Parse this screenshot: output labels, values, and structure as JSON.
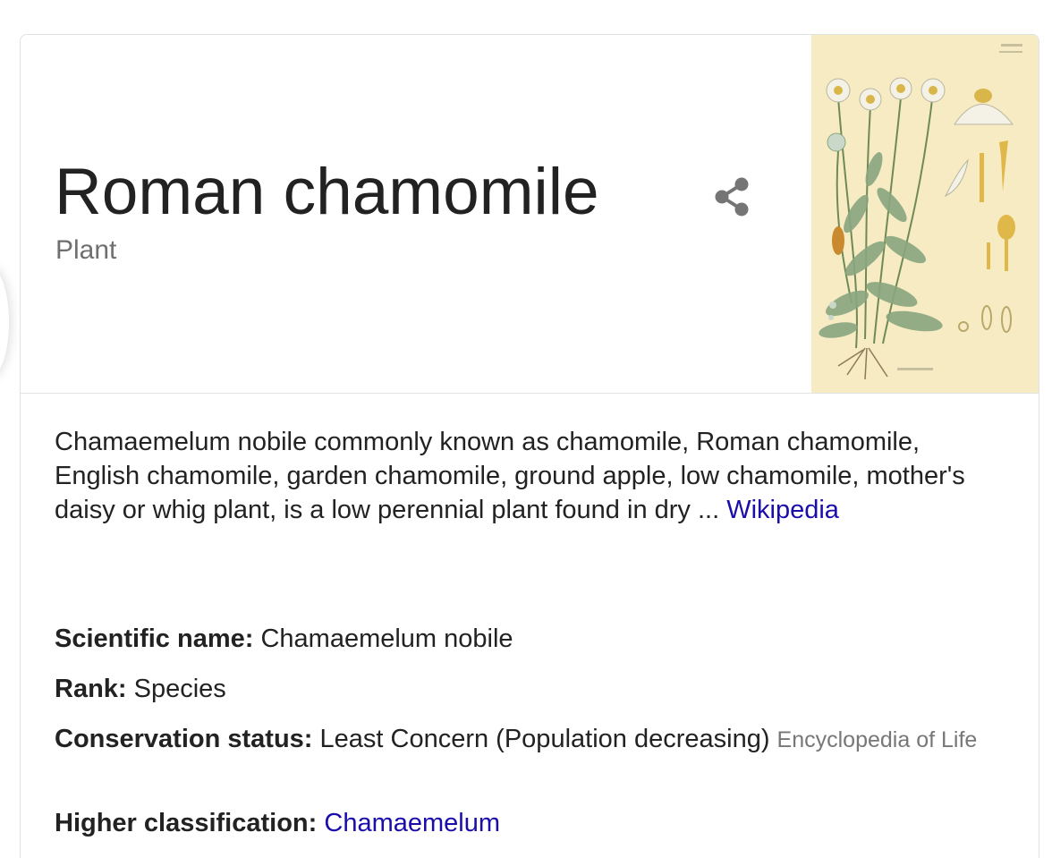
{
  "card": {
    "title": "Roman chamomile",
    "subtitle": "Plant",
    "image_alt": "Botanical illustration of Roman chamomile",
    "description": {
      "text": "Chamaemelum nobile commonly known as chamomile, Roman chamomile, English chamomile, garden chamomile, ground apple, low chamomile, mother's daisy or whig plant, is a low perennial plant found in dry ... ",
      "source_link": "Wikipedia"
    },
    "facts": {
      "scientific_name": {
        "label": "Scientific name:",
        "value": " Chamaemelum nobile"
      },
      "rank": {
        "label": "Rank:",
        "value": " Species"
      },
      "conservation_status": {
        "label": "Conservation status:",
        "value": " Least Concern (Population decreasing) ",
        "source": "Encyclopedia of Life"
      },
      "higher_classification": {
        "label": "Higher classification:",
        "value": "Chamaemelum"
      }
    }
  },
  "colors": {
    "link": "#1a0dab",
    "text": "#222222",
    "muted": "#6f6f6f",
    "share_icon": "#757575",
    "image_bg": "#f6ebc2"
  },
  "icons": {
    "share": "share-icon"
  }
}
